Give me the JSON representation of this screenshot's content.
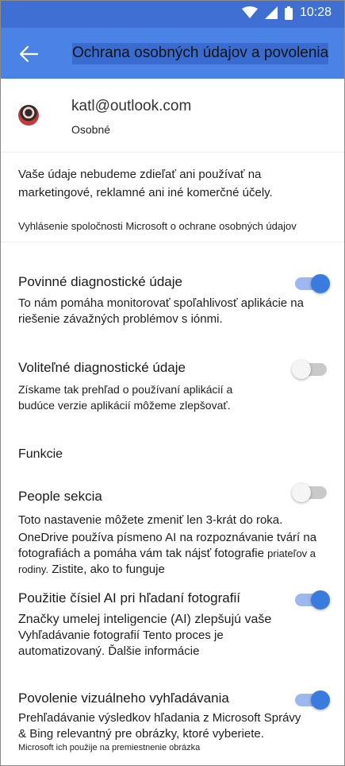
{
  "status_bar": {
    "time": "10:28",
    "icons": [
      "wifi-icon",
      "signal-icon",
      "battery-icon"
    ]
  },
  "header": {
    "title": "Ochrana osobných údajov a povolenia",
    "back_icon": "arrow-left-icon"
  },
  "account": {
    "email": "katl@outlook.com",
    "type": "Osobné"
  },
  "privacy": {
    "statement": "Vaše údaje nebudeme zdieľať ani používať na marketingové, reklamné ani iné komerčné účely.",
    "link": "Vyhlásenie spoločnosti Microsoft o ochrane osobných údajov"
  },
  "settings": {
    "required": {
      "title": "Povinné diagnostické údaje",
      "desc": "To nám pomáha monitorovať spoľahlivosť aplikácie na riešenie závažných problémov s iónmi.",
      "enabled": true
    },
    "optional": {
      "title": "Voliteľné diagnostické údaje",
      "desc": "Získame tak prehľad o používaní aplikácií a budúce verzie aplikácií môžeme zlepšovať.",
      "enabled": false
    }
  },
  "features": {
    "section_title": "Funkcie",
    "people": {
      "title": "People sekcia",
      "limit_note": "Toto nastavenie môžete zmeniť len 3-krát do roka.",
      "desc": "OneDrive používa písmeno AI na rozpoznávanie tvárí na fotografiách a pomáha vám tak nájsť fotografie",
      "desc_small": "priateľov a rodiny.",
      "link": "Zistite, ako to funguje",
      "enabled": false
    },
    "ai_numbers": {
      "title": "Použitie čísiel AI pri hľadaní fotografií",
      "desc_line1": "Značky umelej inteligencie (AI) zlepšujú vaše",
      "desc_rest": "Vyhľadávanie fotografií Tento proces je automatizovaný.",
      "link": "Ďalšie informácie",
      "enabled": true
    },
    "visual_search": {
      "title": "Povolenie vizuálneho vyhľadávania",
      "desc": "Prehľadávanie výsledkov hľadania z Microsoft Správy",
      "desc_amp": "&",
      "desc2": "Bing relevantný pre obrázky, ktoré vyberiete.",
      "desc_small": "Microsoft ich použije na premiestnenie obrázka",
      "enabled": true
    }
  },
  "colors": {
    "status_bar": "#3f6fd3",
    "app_bar": "#4b82e6",
    "toggle_on": "#3a7be0",
    "toggle_off": "#c9c9c9"
  }
}
